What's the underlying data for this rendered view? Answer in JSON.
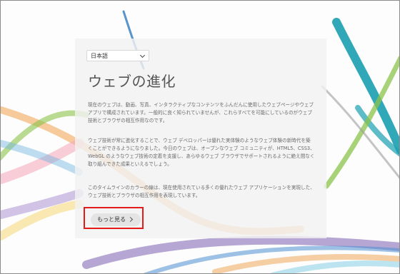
{
  "language_selector": {
    "value": "日本語"
  },
  "title": "ウェブの進化",
  "paragraphs": [
    "現在のウェブは、動画、写真、インタラクティブなコンテンツをふんだんに使用したウェブページやウェブアプリで構成されています。一般的に良く知られていませんが、これらすべてを可能にしているのがウェブ技術とブラウザの相互作用なのです。",
    "ウェブ技術が常に進化することで、ウェブ デベロッパーは優れた実体験のようなウェブ体験の新時代を築くことができるようになりました。今日のウェブは、オープンなウェブ コミュニティが、HTML5、CSS3、WebGL のようなウェブ技術の定着を支援し、あらゆるウェブ ブラウザでサポートされるように絶え間なく取り組んできた成果といえるでしょう。",
    "このタイムラインのカラーの線は、現在使用されている多くの優れたウェブ アプリケーションを実現した、ウェブ技術とブラウザの相互作用を表現しています。"
  ],
  "more_button": {
    "label": "もっと見る"
  },
  "colors": {
    "highlight": "#e31b1b",
    "ribbon_teal": "#1a9fb0",
    "ribbon_green": "#8bc34a",
    "ribbon_orange": "#f0a04b",
    "ribbon_purple": "#7b5fb0",
    "ribbon_blue": "#3b82c4"
  }
}
